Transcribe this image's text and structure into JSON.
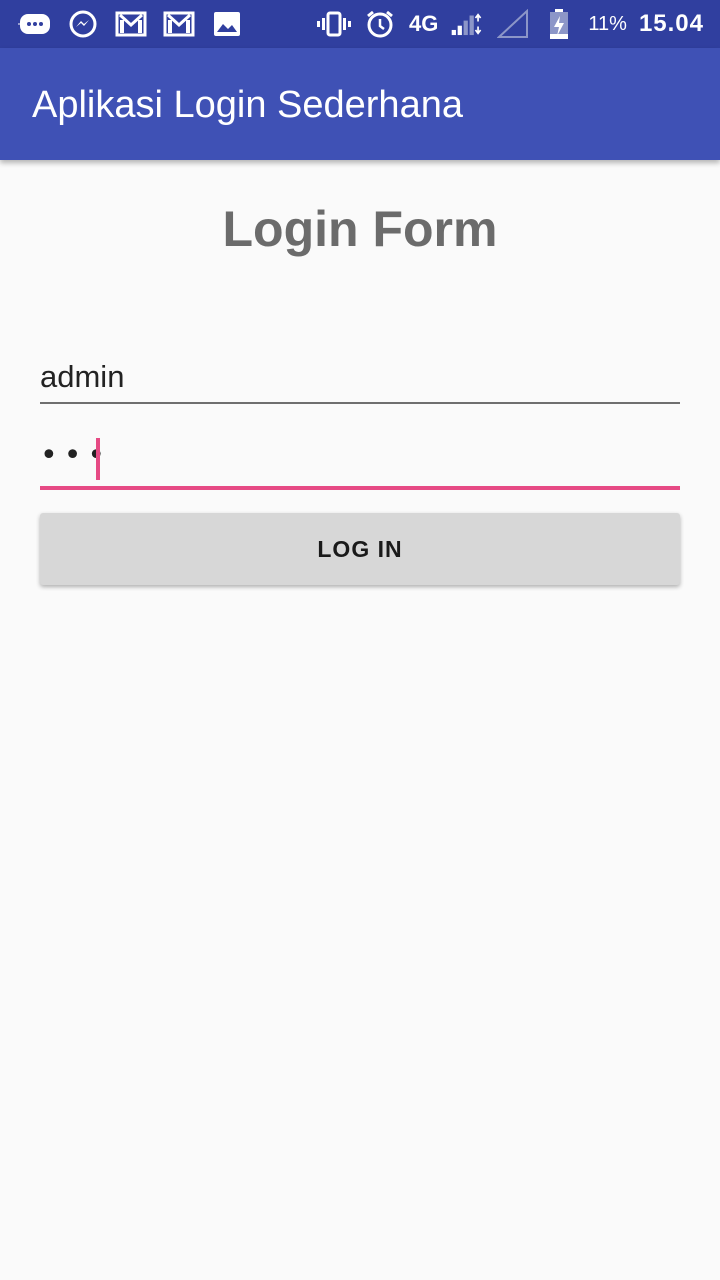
{
  "status_bar": {
    "network": "4G",
    "battery_percent": "11%",
    "time": "15.04",
    "left_icons": [
      "message-icon",
      "messenger-icon",
      "gmail-icon",
      "gmail-icon",
      "image-icon"
    ],
    "right_icons": [
      "vibrate-icon",
      "alarm-icon",
      "signal-icon",
      "no-signal-icon",
      "battery-icon"
    ]
  },
  "app_bar": {
    "title": "Aplikasi Login Sederhana",
    "color": "#3f51b5"
  },
  "form": {
    "title": "Login Form",
    "username": {
      "value": "admin"
    },
    "password": {
      "masked_value": "•••"
    },
    "login_button": {
      "label": "LOG IN"
    },
    "accent_color": "#e64a84"
  }
}
